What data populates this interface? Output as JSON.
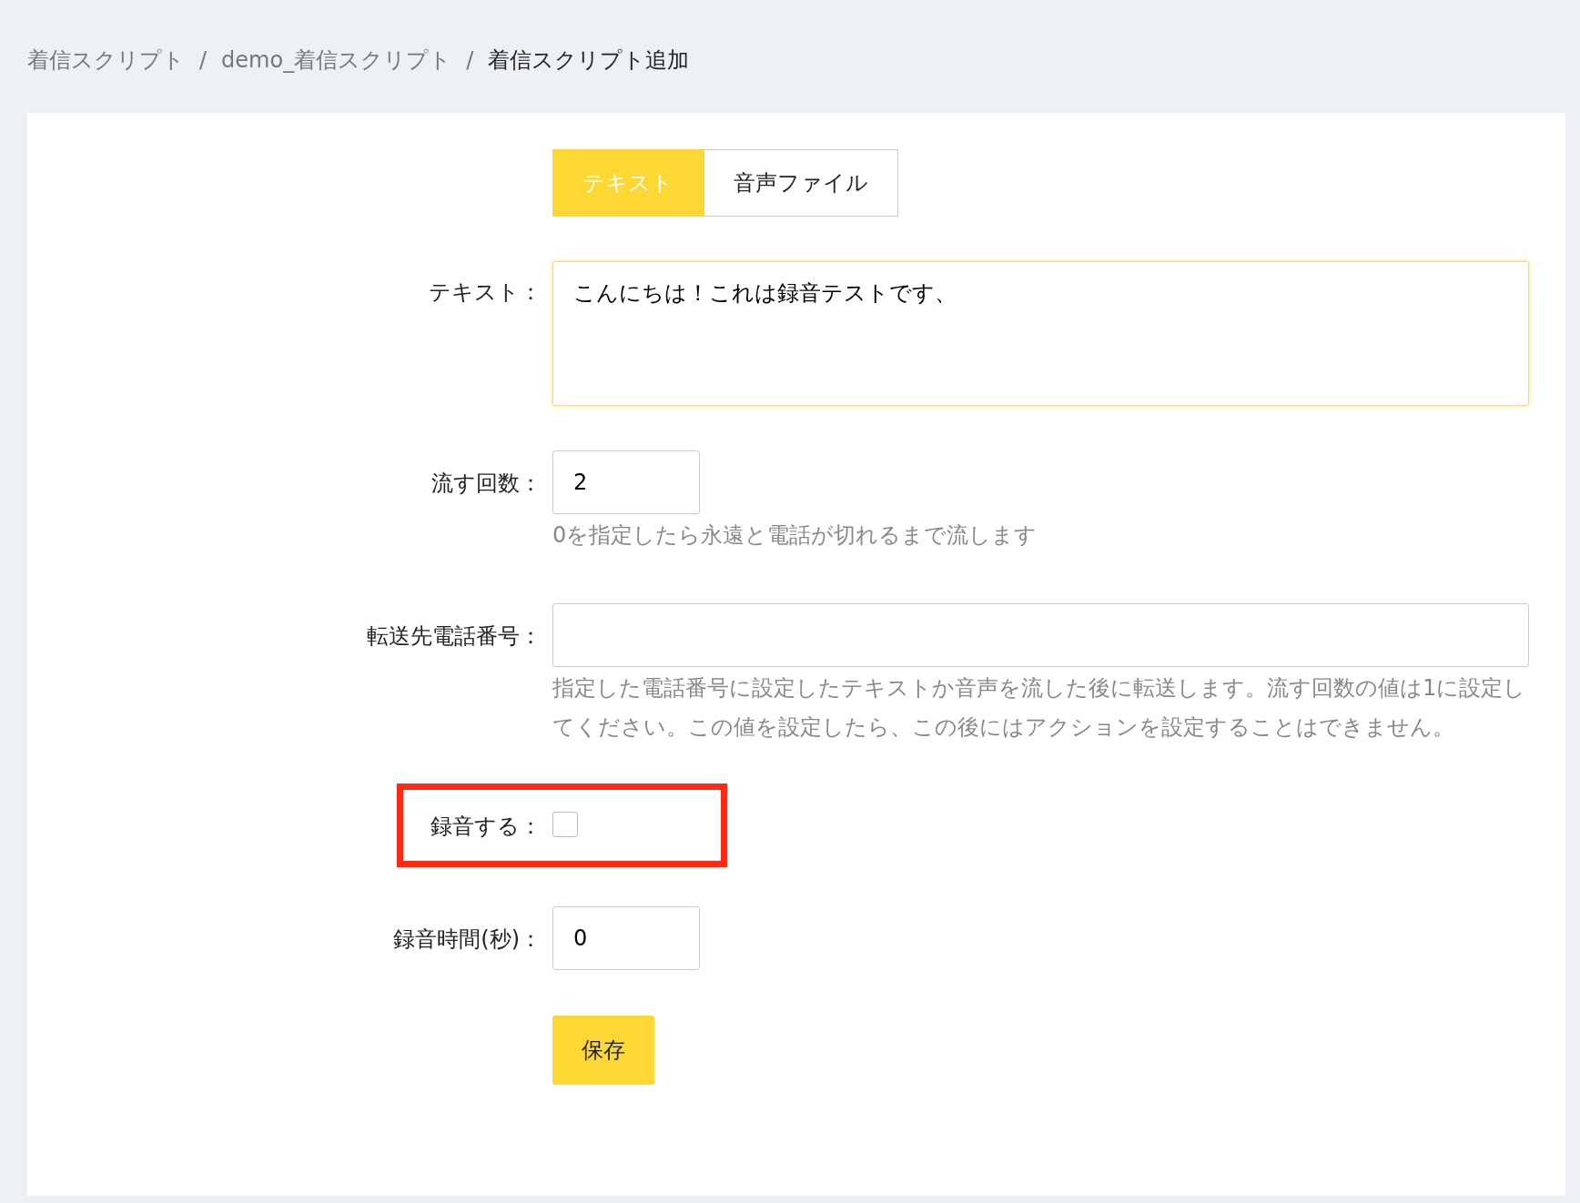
{
  "breadcrumb": [
    {
      "text": "着信スクリプト",
      "current": false
    },
    {
      "separator": "/",
      "text": "demo_着信スクリプト",
      "current": false
    },
    {
      "separator": "/",
      "text": "着信スクリプト追加",
      "current": true
    }
  ],
  "tabs": [
    {
      "label": "テキスト",
      "selected": true
    },
    {
      "label": "音声ファイル",
      "selected": false
    }
  ],
  "fields": [
    {
      "kind": "textarea",
      "label": "テキスト：",
      "value": "こんにちは！これは録音テストです、",
      "focused": true
    },
    {
      "kind": "short",
      "label": "流す回数：",
      "value": "2",
      "help": "0を指定したら永遠と電話が切れるまで流します"
    },
    {
      "kind": "wide",
      "label": "転送先電話番号：",
      "help": "指定した電話番号に設定したテキストか音声を流した後に転送します。流す回数の値は1に設定してください。この値を設定したら、この後にはアクションを設定することはできません。"
    },
    {
      "kind": "checkbox",
      "label": "録音する：",
      "checked": false,
      "highlighted": true
    },
    {
      "kind": "short",
      "label": "録音時間(秒)：",
      "value": "0"
    }
  ],
  "save_button": "保存"
}
